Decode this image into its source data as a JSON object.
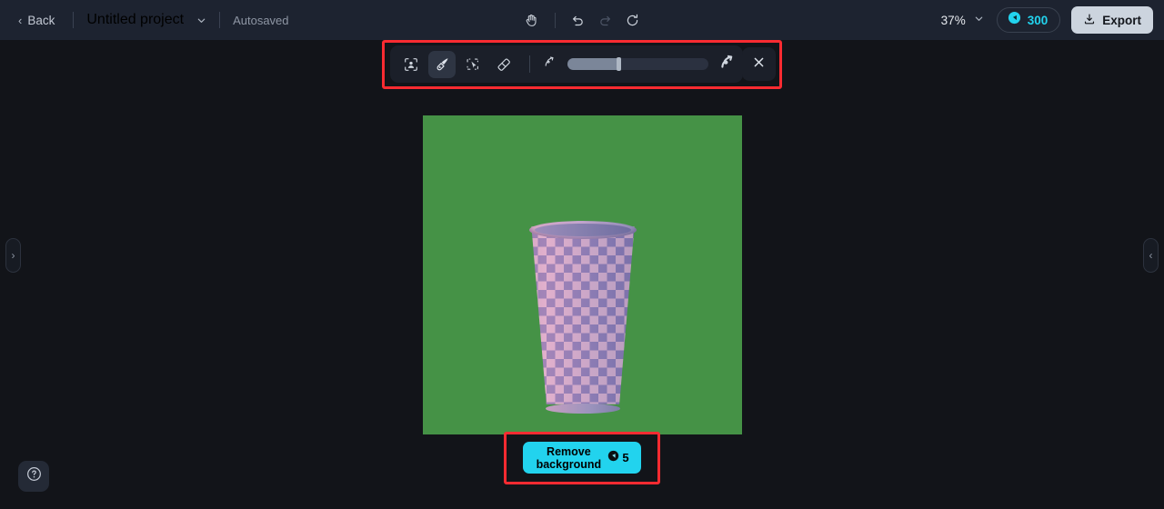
{
  "header": {
    "back_label": "Back",
    "back_chevron": "chevron-left-icon",
    "project_title": "Untitled project",
    "project_caret": "chevron-down-icon",
    "autosaved_label": "Autosaved",
    "center_tools": [
      {
        "name": "hand-tool",
        "icon": "hand-icon",
        "state": "enabled"
      },
      {
        "name": "undo",
        "icon": "undo-icon",
        "state": "enabled"
      },
      {
        "name": "redo",
        "icon": "redo-icon",
        "state": "disabled"
      },
      {
        "name": "reset",
        "icon": "refresh-icon",
        "state": "enabled"
      }
    ],
    "zoom_level": "37%",
    "zoom_caret": "chevron-down-icon",
    "credits_icon": "credit-coin-icon",
    "credits_value": "300",
    "export_icon": "download-icon",
    "export_label": "Export"
  },
  "toolbar": {
    "tools": [
      {
        "name": "select-subject",
        "icon": "person-in-frame-icon",
        "active": false
      },
      {
        "name": "brush",
        "icon": "paintbrush-icon",
        "active": true
      },
      {
        "name": "magic-select",
        "icon": "cursor-selection-icon",
        "active": false
      },
      {
        "name": "eraser",
        "icon": "eraser-icon",
        "active": false
      }
    ],
    "brush_size_small_icon": "brush-size-small-icon",
    "brush_size_large_icon": "brush-size-large-icon",
    "brush_size_percent": 35,
    "close_icon": "close-icon"
  },
  "canvas": {
    "background_color": "#459246",
    "subject": "checkered-pink-purple-cup",
    "colors": {
      "green_background": "#459246",
      "cup_light": "#d9aecb",
      "cup_dark": "#7d7fa8"
    }
  },
  "action_button": {
    "label_line1": "Remove",
    "label_line2": "background",
    "cost_icon": "credit-coin-icon",
    "cost_value": "5",
    "color": "#22d3ee"
  },
  "panels": {
    "left_handle_icon": "chevron-right-icon",
    "left_handle_glyph": "›",
    "right_handle_icon": "chevron-left-icon",
    "right_handle_glyph": "‹"
  },
  "help": {
    "icon": "question-mark-circle-icon"
  },
  "annotations": [
    {
      "name": "toolbar-highlight",
      "color": "#fb2b31"
    },
    {
      "name": "remove-background-highlight",
      "color": "#fb2b31"
    }
  ]
}
